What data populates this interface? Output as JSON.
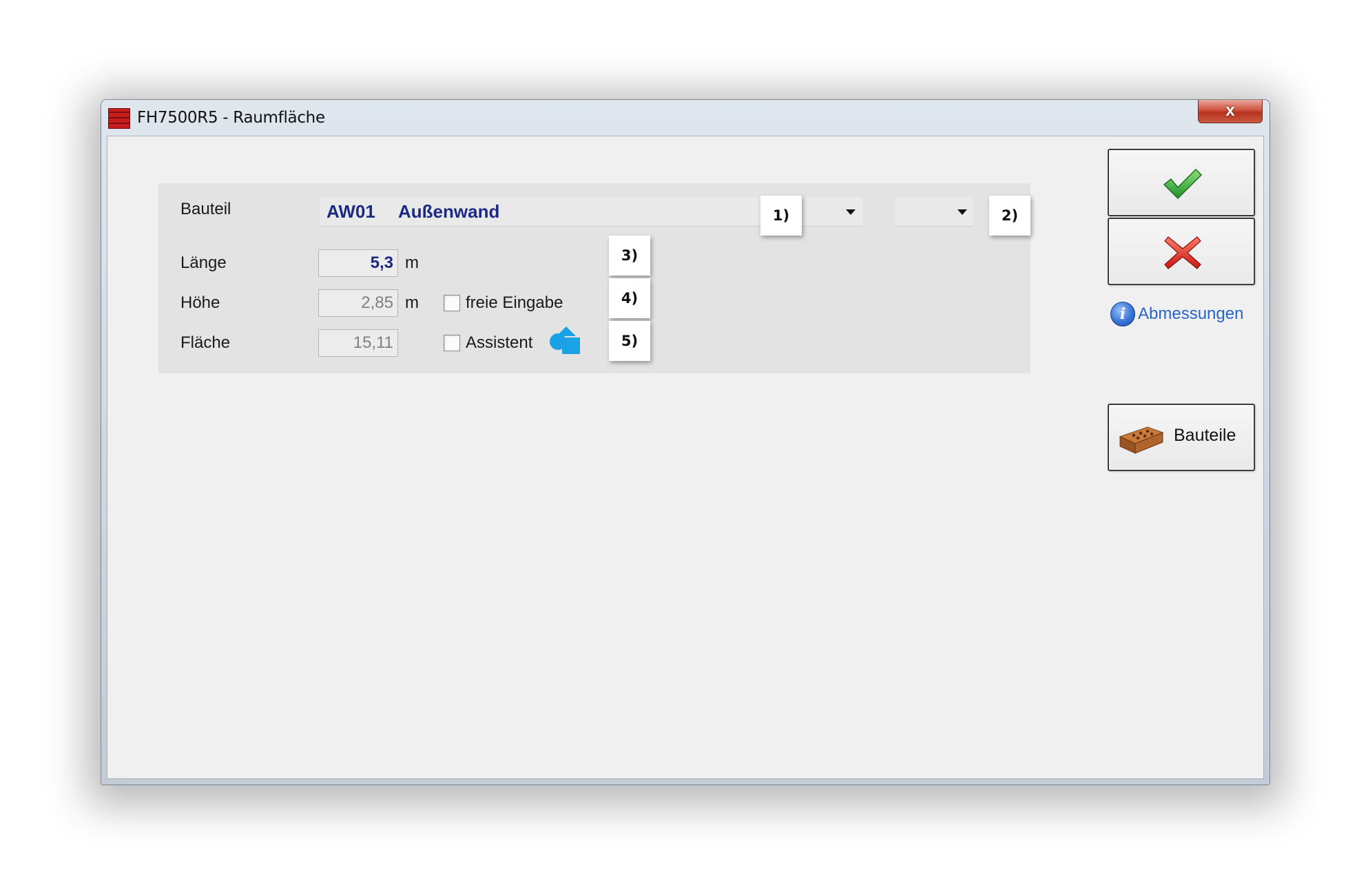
{
  "window": {
    "title": "FH7500R5 - Raumfläche",
    "close_label": "x"
  },
  "form": {
    "bauteil": {
      "label": "Bauteil",
      "code": "AW01",
      "name": "Außenwand"
    },
    "laenge": {
      "label": "Länge",
      "value": "5,3",
      "unit": "m"
    },
    "hoehe": {
      "label": "Höhe",
      "value": "2,85",
      "unit": "m"
    },
    "flaeche": {
      "label": "Fläche",
      "value": "15,11"
    },
    "freie_eingabe": {
      "label": "freie Eingabe",
      "checked": false
    },
    "assistent": {
      "label": "Assistent",
      "checked": false
    }
  },
  "markers": [
    "1)",
    "2)",
    "3)",
    "4)",
    "5)"
  ],
  "sidebar": {
    "ok_icon": "checkmark-icon",
    "cancel_icon": "cancel-icon",
    "info_link": "Abmessungen",
    "bauteile_button": "Bauteile"
  },
  "colors": {
    "value_blue": "#1c2a86",
    "link_blue": "#2a64c6",
    "ok_green": "#3bb13b",
    "cancel_red": "#e0261e"
  }
}
